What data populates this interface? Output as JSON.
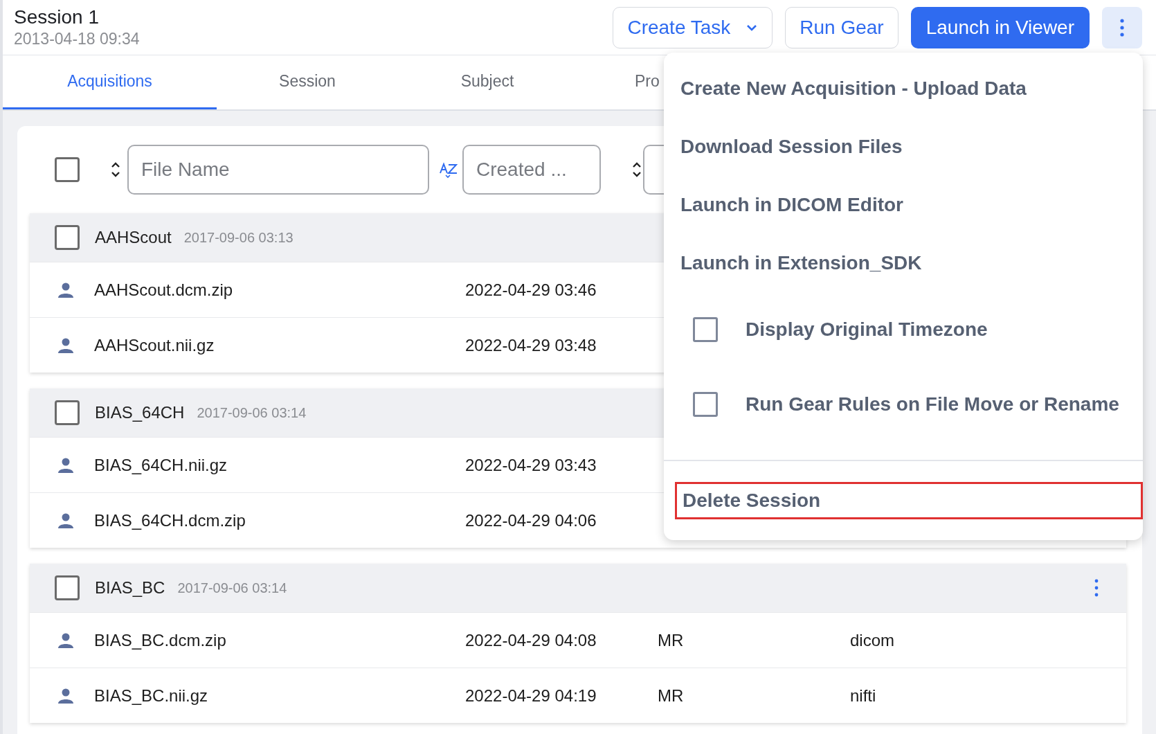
{
  "header": {
    "title": "Session 1",
    "date": "2013-04-18 09:34"
  },
  "actions": [
    {
      "label": "Create Task",
      "kind": "dropdown"
    },
    {
      "label": "Run Gear",
      "kind": "outline"
    },
    {
      "label": "Launch in Viewer",
      "kind": "primary"
    },
    {
      "kind": "kebab",
      "selected": true
    }
  ],
  "tabs": [
    {
      "label": "Acquisitions",
      "selected": true
    },
    {
      "label": "Session",
      "selected": false
    },
    {
      "label": "Subject",
      "selected": false
    },
    {
      "label": "Pro",
      "selected": false
    }
  ],
  "toolbar": {
    "select_all_checked": false,
    "filters": [
      {
        "placeholder": "File Name",
        "kind": "updown"
      },
      {
        "placeholder": "Created ...",
        "kind": "az"
      },
      {
        "kind": "updown"
      }
    ]
  },
  "acquisitions": [
    {
      "name": "AAHScout",
      "date": "2017-09-06 03:13",
      "checked": false,
      "files": [
        {
          "name": "AAHScout.dcm.zip",
          "created": "2022-04-29 03:46"
        },
        {
          "name": "AAHScout.nii.gz",
          "created": "2022-04-29 03:48"
        }
      ]
    },
    {
      "name": "BIAS_64CH",
      "date": "2017-09-06 03:14",
      "checked": false,
      "files": [
        {
          "name": "BIAS_64CH.nii.gz",
          "created": "2022-04-29 03:43"
        },
        {
          "name": "BIAS_64CH.dcm.zip",
          "created": "2022-04-29 04:06"
        }
      ]
    },
    {
      "name": "BIAS_BC",
      "date": "2017-09-06 03:14",
      "checked": false,
      "menu": true,
      "files": [
        {
          "name": "BIAS_BC.dcm.zip",
          "created": "2022-04-29 04:08",
          "modality": "MR",
          "type": "dicom"
        },
        {
          "name": "BIAS_BC.nii.gz",
          "created": "2022-04-29 04:19",
          "modality": "MR",
          "type": "nifti"
        }
      ]
    }
  ],
  "menu": {
    "items": [
      {
        "kind": "action",
        "label": "Create New Acquisition - Upload Data"
      },
      {
        "kind": "action",
        "label": "Download Session Files"
      },
      {
        "kind": "action",
        "label": "Launch in DICOM Editor"
      },
      {
        "kind": "action",
        "label": "Launch in Extension_SDK"
      },
      {
        "kind": "checkbox",
        "label": "Display Original Timezone",
        "checked": false
      },
      {
        "kind": "checkbox",
        "label": "Run Gear Rules on File Move or Rename",
        "checked": false
      }
    ],
    "footer_item": {
      "label": "Delete Session",
      "highlighted": true
    }
  }
}
